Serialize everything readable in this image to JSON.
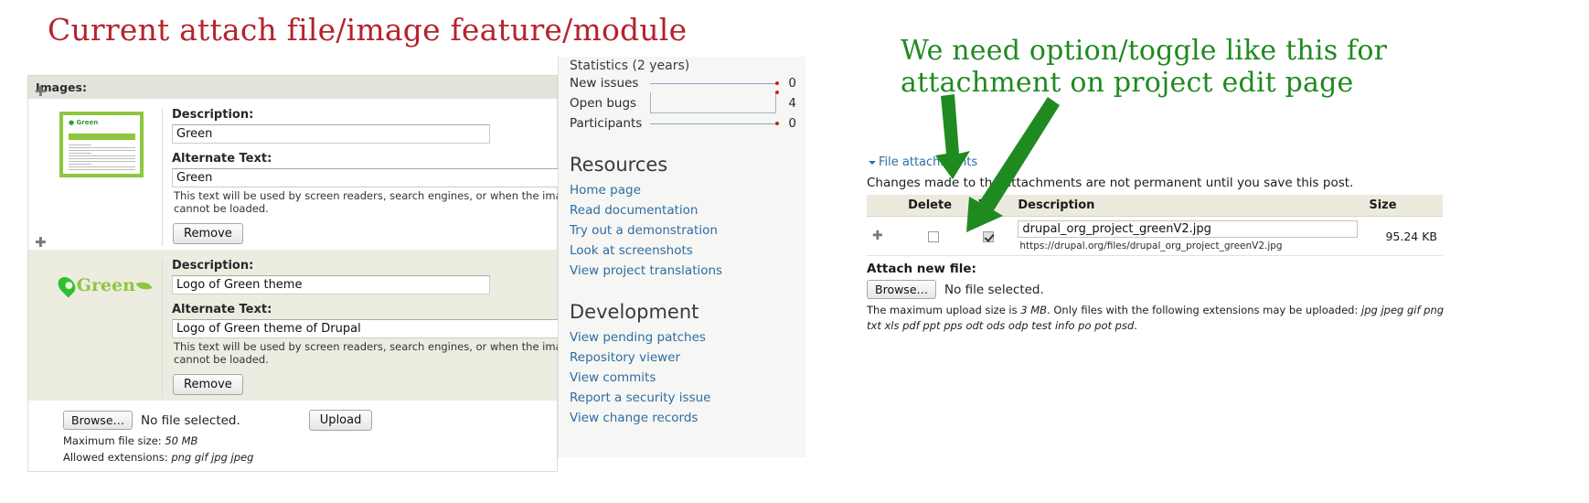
{
  "annotations": {
    "left": "Current attach file/image feature/module",
    "left_color": "#b5232c",
    "right": "We need option/toggle like this for\nattachment on project edit page",
    "right_color": "#1f8a1f"
  },
  "left_panel": {
    "header": "Images:",
    "rows": [
      {
        "drag_handle": "move-handle-icon",
        "thumb_label": "Green",
        "description_label": "Description:",
        "description_value": "Green",
        "alt_label": "Alternate Text:",
        "alt_value": "Green",
        "alt_help": "This text will be used by screen readers, search engines, or when the image cannot be loaded.",
        "remove_label": "Remove"
      },
      {
        "drag_handle": "move-handle-icon",
        "thumb_label": "Green",
        "description_label": "Description:",
        "description_value": "Logo of Green theme",
        "alt_label": "Alternate Text:",
        "alt_value": "Logo of Green theme of Drupal",
        "alt_help": "This text will be used by screen readers, search engines, or when the image cannot be loaded.",
        "remove_label": "Remove"
      }
    ],
    "upload": {
      "browse_label": "Browse…",
      "no_file_text": "No file selected.",
      "upload_label": "Upload",
      "max_size_label": "Maximum file size:",
      "max_size_value": "50 MB",
      "extensions_label": "Allowed extensions:",
      "extensions_value": "png gif jpg jpeg"
    }
  },
  "sidebar": {
    "stats_title": "Statistics (2 years)",
    "stats": [
      {
        "name": "New issues",
        "value": "0",
        "style": "line"
      },
      {
        "name": "Open bugs",
        "value": "4",
        "style": "box"
      },
      {
        "name": "Participants",
        "value": "0",
        "style": "line"
      }
    ],
    "sections": [
      {
        "title": "Resources",
        "links": [
          "Home page",
          "Read documentation",
          "Try out a demonstration",
          "Look at screenshots",
          "View project translations"
        ]
      },
      {
        "title": "Development",
        "links": [
          "View pending patches",
          "Repository viewer",
          "View commits",
          "Report a security issue",
          "View change records"
        ]
      }
    ]
  },
  "attachments": {
    "toggle_label": "File attachments",
    "note": "Changes made to the attachments are not permanent until you save this post.",
    "columns": [
      "",
      "Delete",
      "List",
      "Description",
      "Size"
    ],
    "rows": [
      {
        "drag_handle": "move-handle-icon",
        "delete_checked": false,
        "list_checked": true,
        "description": "drupal_org_project_greenV2.jpg",
        "url": "https://drupal.org/files/drupal_org_project_greenV2.jpg",
        "size": "95.24 KB"
      }
    ],
    "attach_label": "Attach new file:",
    "browse_label": "Browse…",
    "no_file_text": "No file selected.",
    "help_prefix": "The maximum upload size is",
    "help_size": "3 MB",
    "help_mid": ". Only files with the following extensions may be uploaded:",
    "help_extensions": "jpg jpeg gif png txt xls pdf ppt pps odt ods odp test info po pot psd",
    "help_suffix": "."
  }
}
